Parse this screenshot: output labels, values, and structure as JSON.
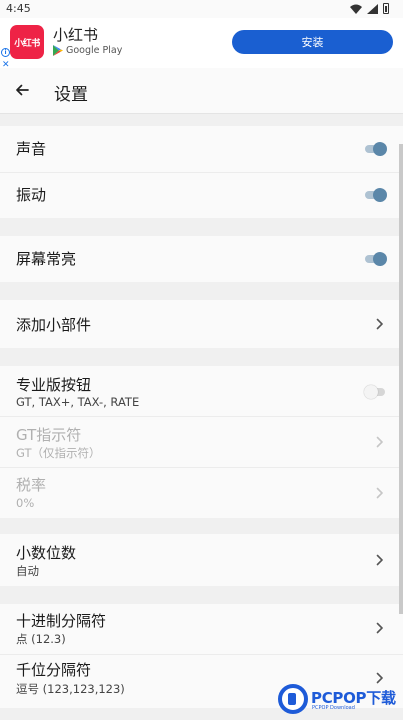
{
  "status_bar": {
    "time": "4:45"
  },
  "ad": {
    "logo_text": "小红书",
    "app_name": "小红书",
    "store": "Google Play",
    "install_label": "安装",
    "info_glyph": "i",
    "close_glyph": "✕",
    "brand_color": "#ee2346",
    "button_color": "#1a5fd1"
  },
  "app_bar": {
    "title": "设置"
  },
  "settings": {
    "sound": {
      "title": "声音",
      "enabled": true
    },
    "vibration": {
      "title": "振动",
      "enabled": true
    },
    "keep_screen_on": {
      "title": "屏幕常亮",
      "enabled": true
    },
    "add_widget": {
      "title": "添加小部件"
    },
    "pro_buttons": {
      "title": "专业版按钮",
      "subtitle": "GT, TAX+, TAX-, RATE",
      "enabled": false
    },
    "gt_indicator": {
      "title": "GT指示符",
      "subtitle": "GT（仅指示符）"
    },
    "tax_rate": {
      "title": "税率",
      "subtitle": "0%"
    },
    "decimal_places": {
      "title": "小数位数",
      "subtitle": "自动"
    },
    "decimal_separator": {
      "title": "十进制分隔符",
      "subtitle": "点 (12.3)"
    },
    "thousands_separator": {
      "title": "千位分隔符",
      "subtitle": "逗号 (123,123,123)"
    }
  },
  "colors": {
    "toggle_on": "#5b87a9",
    "watermark": "#1e5bd8"
  },
  "watermark": {
    "text": "PCPOP下载",
    "sub": "PCPOP Download"
  }
}
